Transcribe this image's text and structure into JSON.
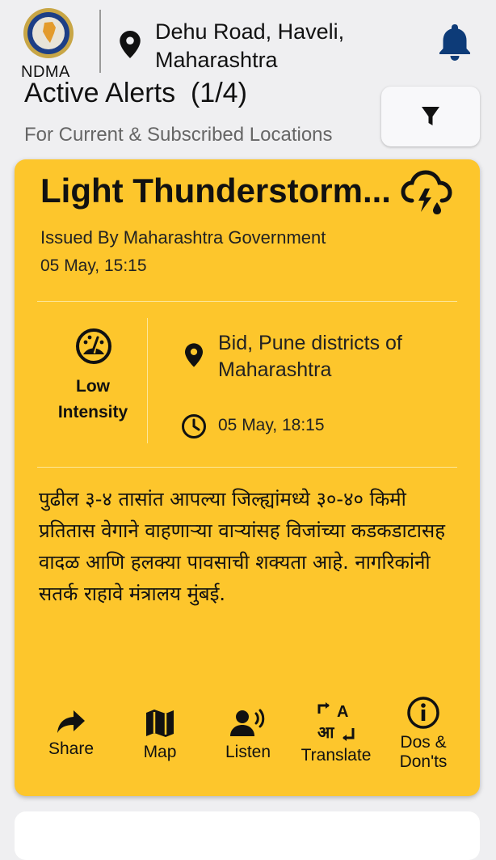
{
  "header": {
    "logo_text": "NDMA",
    "location_line1": "Dehu Road, Haveli,",
    "location_line2": "Maharashtra"
  },
  "alerts": {
    "title": "Active Alerts",
    "count": "(1/4)",
    "subtitle": "For Current & Subscribed Locations"
  },
  "card": {
    "title": "Light Thunderstorm...",
    "issued_by": "Issued By Maharashtra Government",
    "issued_time": "05 May, 15:15",
    "intensity_line1": "Low",
    "intensity_line2": "Intensity",
    "area_line1": "Bid, Pune districts of",
    "area_line2": "Maharashtra",
    "expiry_time": "05 May, 18:15",
    "message": "पुढील ३-४ तासांत आपल्या जिल्ह्यांमध्ये ३०-४० किमी प्रतितास वेगाने वाहणाऱ्या वाऱ्यांसह विजांच्या कडकडाटासह वादळ आणि हलक्या पावसाची शक्यता आहे. नागरिकांनी सतर्क राहावे मंत्रालय मुंबई."
  },
  "actions": {
    "share": "Share",
    "map": "Map",
    "listen": "Listen",
    "translate": "Translate",
    "dos_line1": "Dos &",
    "dos_line2": "Don'ts"
  },
  "colors": {
    "card_bg": "#fdc62c",
    "bell": "#0d3b78",
    "page_bg": "#efeff1"
  }
}
